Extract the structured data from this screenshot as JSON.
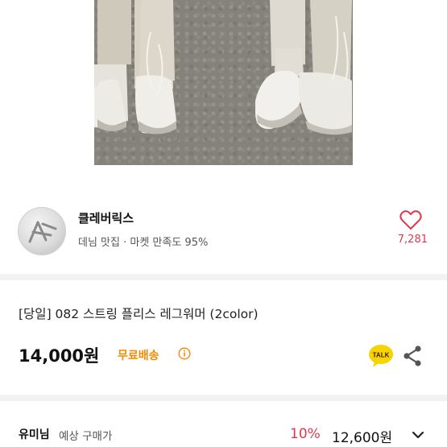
{
  "product": {
    "image_alt": "product-photo",
    "title": "[당일] 082 스트링 플리스 레그워머 (2color)",
    "price": "14,000원",
    "shipping": "무료배송"
  },
  "seller": {
    "name": "클레버릭스",
    "subtitle": "데님 맛집 · 마켓 만족도 95%",
    "like_count": "7,281"
  },
  "member_price": {
    "name": "유미님",
    "label": "예상 구매가",
    "discount": "10%",
    "price": "12,600원"
  },
  "colors": {
    "accent_red": "#e0394e",
    "shipping_orange": "#f08c00",
    "talk_yellow": "#f7d300"
  },
  "icons": {
    "like": "heart-icon",
    "shipping_info": "info-circle-icon",
    "talk": "kakao-talk-icon",
    "share": "share-icon",
    "expand": "chevron-down-icon"
  }
}
